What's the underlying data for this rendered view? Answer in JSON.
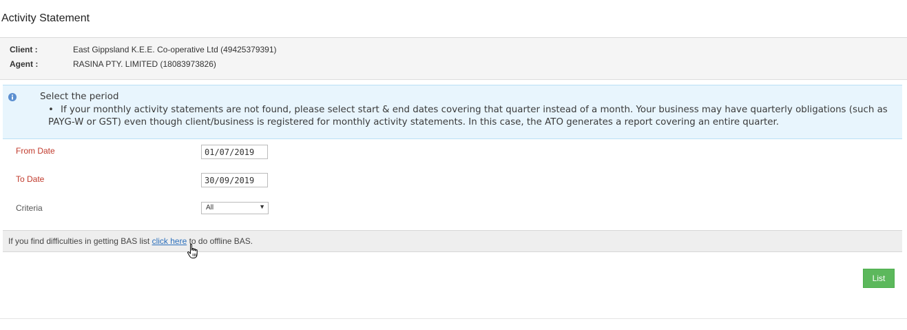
{
  "page": {
    "title": "Activity Statement"
  },
  "client_info": {
    "client_label": "Client :",
    "client_value": "East Gippsland K.E.E. Co-operative Ltd (49425379391)",
    "agent_label": "Agent :",
    "agent_value": "RASINA PTY. LIMITED (18083973826)"
  },
  "info": {
    "icon": "info-icon",
    "title": "Select the period",
    "bullet": "If your monthly activity statements are not found, please select start & end dates covering that quarter instead of a month. Your business may have quarterly obligations (such as PAYG-W or GST) even though client/business is registered for monthly activity statements. In this case, the ATO generates a report covering an entire quarter."
  },
  "form": {
    "from_label": "From Date",
    "from_value": "01/07/2019",
    "to_label": "To Date",
    "to_value": "30/09/2019",
    "criteria_label": "Criteria",
    "criteria_value": "All"
  },
  "notice": {
    "prefix": "If you find difficulties in getting BAS list ",
    "link_text": "click here",
    "suffix": " to do offline BAS."
  },
  "actions": {
    "list_label": "List"
  },
  "colors": {
    "required_label": "#c0392b",
    "info_background": "#e8f5fd",
    "list_button": "#5cb85c",
    "link": "#2a6ebb"
  }
}
